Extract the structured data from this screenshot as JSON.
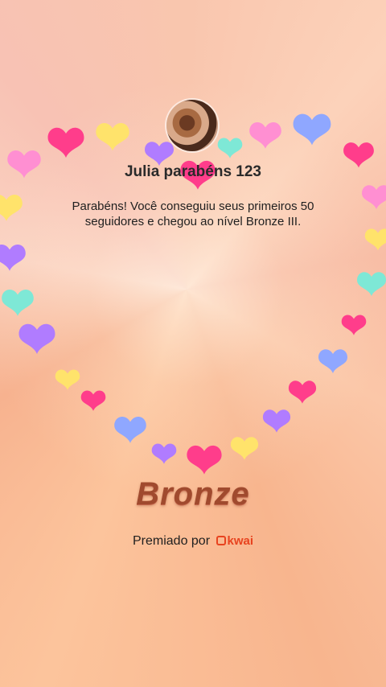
{
  "profile": {
    "username": "Julia parabéns 123",
    "avatar_icon": "user-avatar"
  },
  "message": "Parabéns! Você conseguiu seus primeiros 50 seguidores e chegou ao nível Bronze III.",
  "level": {
    "name": "Bronze",
    "color": "#a04a2e"
  },
  "awarded": {
    "label": "Premiado por",
    "brand": "kwai",
    "brand_color": "#e8431f"
  },
  "decoration": {
    "icon": "heart-emoji-icon",
    "colors": [
      "#ff3d8b",
      "#ffe36b",
      "#b07cff",
      "#8fa7ff",
      "#7ee8d6",
      "#ff8fd2"
    ]
  }
}
